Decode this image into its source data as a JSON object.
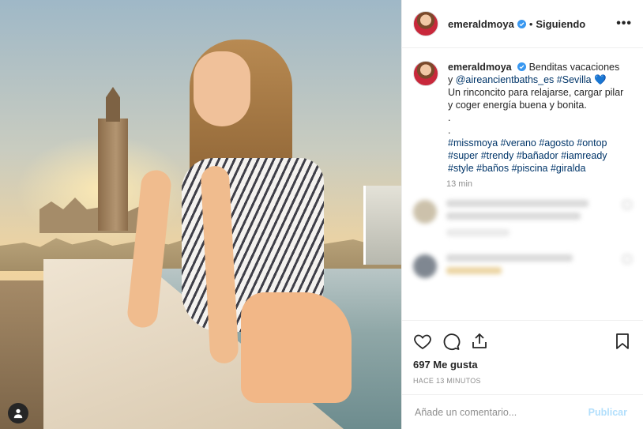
{
  "post": {
    "username": "emeraldmoya",
    "follow_status": "Siguiendo",
    "dot": "•",
    "more": "•••",
    "caption_line1_rest": "Benditas vacaciones",
    "caption_y": "y",
    "caption_mention": "@aireancientbaths_es",
    "caption_hashtag_sevilla": "#Sevilla",
    "caption_heart": "💙",
    "caption_line3": "Un rinconcito para relajarse, cargar pilar y coger energía buena y bonita.",
    "caption_dot1": ".",
    "caption_dot2": ".",
    "caption_hashtags": "#missmoya #verano #agosto #ontop #super #trendy #bañador #iamready #style #baños #piscina #giralda",
    "caption_age": "13 min",
    "likes": "697 Me gusta",
    "age": "HACE 13 MINUTOS",
    "comment_placeholder": "Añade un comentario...",
    "publish_label": "Publicar"
  },
  "colors": {
    "link": "#003569",
    "verified": "#3897f0",
    "publish_disabled": "#b2dffc"
  },
  "icons": [
    "verified-icon",
    "more-icon",
    "heart-icon",
    "comment-icon",
    "share-icon",
    "save-icon",
    "user-icon"
  ]
}
